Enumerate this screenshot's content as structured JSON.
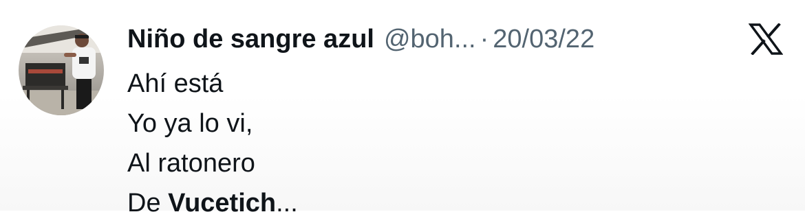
{
  "tweet": {
    "display_name": "Niño de sangre azul",
    "handle": "@boh...",
    "separator": "·",
    "date": "20/03/22",
    "lines": [
      "Ahí está",
      "Yo ya lo vi,",
      "Al ratonero"
    ],
    "last_line_prefix": "De ",
    "last_line_bold": "Vucetich",
    "last_line_suffix": "..."
  },
  "icons": {
    "platform": "x-logo-icon",
    "avatar": "avatar-image"
  },
  "colors": {
    "text": "#0f1419",
    "muted": "#536471",
    "background": "#ffffff"
  }
}
